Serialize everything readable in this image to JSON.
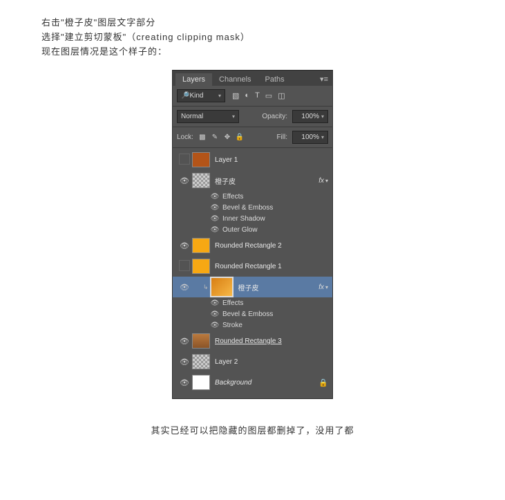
{
  "intro": {
    "line1": "右击\"橙子皮\"图层文字部分",
    "line2": "选择\"建立剪切蒙板\"（creating clipping mask）",
    "line3": "现在图层情况是这个样子的："
  },
  "tabs": {
    "layers": "Layers",
    "channels": "Channels",
    "paths": "Paths"
  },
  "filter": {
    "kind": "Kind"
  },
  "blend": {
    "mode": "Normal",
    "opacity_lbl": "Opacity:",
    "opacity": "100%"
  },
  "lock": {
    "lbl": "Lock:",
    "fill_lbl": "Fill:",
    "fill": "100%"
  },
  "layers": [
    {
      "vis": false,
      "name": "Layer 1",
      "indent": 0,
      "thumb": "#b35418",
      "effects": []
    },
    {
      "vis": true,
      "name": "橙子皮",
      "indent": 0,
      "thumb": "checker",
      "fx": true,
      "effects": [
        "Effects",
        "Bevel & Emboss",
        "Inner Shadow",
        "Outer Glow"
      ]
    },
    {
      "vis": true,
      "name": "Rounded Rectangle 2",
      "indent": 0,
      "thumb": "#f7a813",
      "effects": []
    },
    {
      "vis": false,
      "name": "Rounded Rectangle 1",
      "indent": 0,
      "thumb": "#f7a813",
      "effects": []
    },
    {
      "vis": true,
      "name": "橙子皮",
      "indent": 1,
      "thumb": "linear-gradient(135deg,#d87e12,#f7b847)",
      "big": true,
      "selected": true,
      "clip": true,
      "fx": true,
      "effects": [
        "Effects",
        "Bevel & Emboss",
        "Stroke"
      ]
    },
    {
      "vis": true,
      "name": "Rounded Rectangle 3",
      "indent": 0,
      "thumb": "linear-gradient(#bb7a3e,#8a5428)",
      "under": true,
      "effects": []
    },
    {
      "vis": true,
      "name": "Layer 2",
      "indent": 0,
      "thumb": "checker",
      "effects": []
    },
    {
      "vis": true,
      "name": "Background",
      "indent": 0,
      "thumb": "#ffffff",
      "italic": true,
      "locked": true,
      "effects": []
    }
  ],
  "outro": "其实已经可以把隐藏的图层都删掉了，没用了都"
}
